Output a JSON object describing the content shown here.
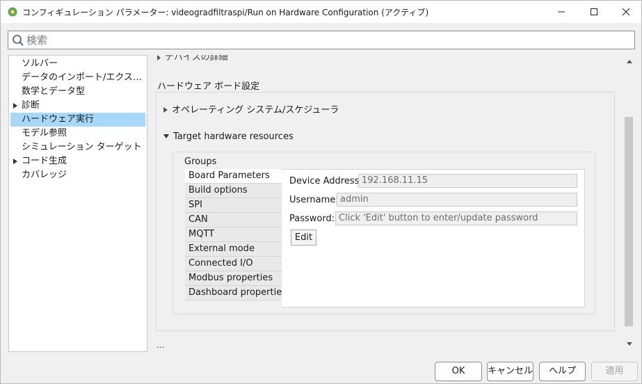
{
  "window": {
    "title": "コンフィギュレーション パラメーター: videogradfiltraspi/Run on Hardware Configuration (アクティブ)"
  },
  "search": {
    "placeholder": "検索",
    "value": ""
  },
  "tree": {
    "items": [
      {
        "label": "ソルバー",
        "expandable": false,
        "selected": false
      },
      {
        "label": "データのインポート/エクスポート",
        "expandable": false,
        "selected": false
      },
      {
        "label": "数学とデータ型",
        "expandable": false,
        "selected": false
      },
      {
        "label": "診断",
        "expandable": true,
        "selected": false
      },
      {
        "label": "ハードウェア実行",
        "expandable": false,
        "selected": true
      },
      {
        "label": "モデル参照",
        "expandable": false,
        "selected": false
      },
      {
        "label": "シミュレーション ターゲット",
        "expandable": false,
        "selected": false
      },
      {
        "label": "コード生成",
        "expandable": true,
        "selected": false
      },
      {
        "label": "カバレッジ",
        "expandable": false,
        "selected": false
      }
    ]
  },
  "panel": {
    "cut_off_label": "デバイスの詳細",
    "section_title": "ハードウェア ボード設定",
    "os_scheduler_label": "オペレーティング システム/スケジューラ",
    "target_resources_label": "Target hardware resources",
    "groups_label": "Groups",
    "groups": [
      {
        "label": "Board Parameters",
        "active": true
      },
      {
        "label": "Build options",
        "active": false
      },
      {
        "label": "SPI",
        "active": false
      },
      {
        "label": "CAN",
        "active": false
      },
      {
        "label": "MQTT",
        "active": false
      },
      {
        "label": "External mode",
        "active": false
      },
      {
        "label": "Connected I/O",
        "active": false
      },
      {
        "label": "Modbus properties",
        "active": false
      },
      {
        "label": "Dashboard properties",
        "active": false
      }
    ],
    "fields": {
      "device_address_label": "Device Address:",
      "device_address_value": "192.168.11.15",
      "username_label": "Username:",
      "username_value": "admin",
      "password_label": "Password:",
      "password_value": "Click 'Edit' button to enter/update password"
    },
    "edit_label": "Edit",
    "more_label": "..."
  },
  "buttons": {
    "ok": "OK",
    "cancel": "キャンセル",
    "help": "ヘルプ",
    "apply": "適用"
  },
  "colors": {
    "selected_tree_bg": "#a7d8f7",
    "window_bg": "#f0f0f0"
  }
}
